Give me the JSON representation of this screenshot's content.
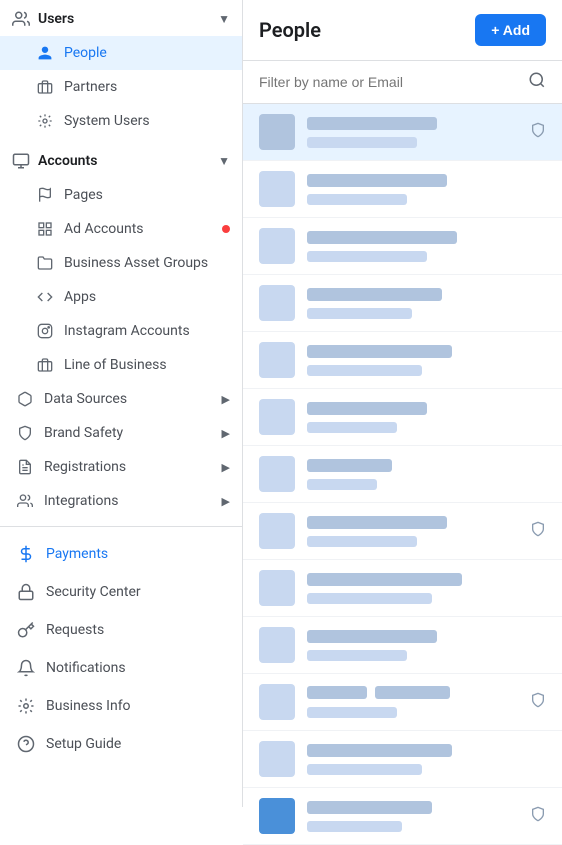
{
  "sidebar": {
    "users_section": {
      "title": "Users",
      "items": [
        {
          "id": "people",
          "label": "People",
          "active": true,
          "icon": "person"
        },
        {
          "id": "partners",
          "label": "Partners",
          "active": false,
          "icon": "handshake"
        },
        {
          "id": "system-users",
          "label": "System Users",
          "active": false,
          "icon": "settings"
        }
      ]
    },
    "accounts_section": {
      "title": "Accounts",
      "items": [
        {
          "id": "pages",
          "label": "Pages",
          "active": false,
          "icon": "flag",
          "dot": false
        },
        {
          "id": "ad-accounts",
          "label": "Ad Accounts",
          "active": false,
          "icon": "grid",
          "dot": true
        },
        {
          "id": "business-asset-groups",
          "label": "Business Asset Groups",
          "active": false,
          "icon": "folder",
          "dot": false
        },
        {
          "id": "apps",
          "label": "Apps",
          "active": false,
          "icon": "apps",
          "dot": false
        },
        {
          "id": "instagram-accounts",
          "label": "Instagram Accounts",
          "active": false,
          "icon": "instagram",
          "dot": false
        },
        {
          "id": "line-of-business",
          "label": "Line of Business",
          "active": false,
          "icon": "briefcase",
          "dot": false
        }
      ]
    },
    "sub_items": [
      {
        "id": "data-sources",
        "label": "Data Sources",
        "icon": "database",
        "has_arrow": true
      },
      {
        "id": "brand-safety",
        "label": "Brand Safety",
        "icon": "shield",
        "has_arrow": true
      },
      {
        "id": "registrations",
        "label": "Registrations",
        "icon": "clipboard",
        "has_arrow": true
      },
      {
        "id": "integrations",
        "label": "Integrations",
        "icon": "people-group",
        "has_arrow": true
      }
    ],
    "bottom_items": [
      {
        "id": "payments",
        "label": "Payments",
        "icon": "credit-card",
        "color": "#1877f2"
      },
      {
        "id": "security-center",
        "label": "Security Center",
        "icon": "lock",
        "color": "#4b4f56"
      },
      {
        "id": "requests",
        "label": "Requests",
        "icon": "key",
        "color": "#4b4f56"
      },
      {
        "id": "notifications",
        "label": "Notifications",
        "icon": "bell",
        "color": "#4b4f56"
      },
      {
        "id": "business-info",
        "label": "Business Info",
        "icon": "gear",
        "color": "#4b4f56"
      },
      {
        "id": "setup-guide",
        "label": "Setup Guide",
        "icon": "question",
        "color": "#4b4f56"
      }
    ]
  },
  "main": {
    "title": "People",
    "add_button_label": "+ Add",
    "filter_placeholder": "Filter by name or Email",
    "rows": [
      {
        "id": 1,
        "has_shield": true,
        "highlighted": true,
        "name_width": 130,
        "email_width": 110
      },
      {
        "id": 2,
        "has_shield": false,
        "highlighted": false,
        "name_width": 140,
        "email_width": 100
      },
      {
        "id": 3,
        "has_shield": false,
        "highlighted": false,
        "name_width": 150,
        "email_width": 120
      },
      {
        "id": 4,
        "has_shield": false,
        "highlighted": false,
        "name_width": 135,
        "email_width": 105
      },
      {
        "id": 5,
        "has_shield": false,
        "highlighted": false,
        "name_width": 145,
        "email_width": 115
      },
      {
        "id": 6,
        "has_shield": false,
        "highlighted": false,
        "name_width": 120,
        "email_width": 90
      },
      {
        "id": 7,
        "has_shield": false,
        "highlighted": false,
        "name_width": 100,
        "email_width": 80
      },
      {
        "id": 8,
        "has_shield": true,
        "highlighted": false,
        "name_width": 140,
        "email_width": 110
      },
      {
        "id": 9,
        "has_shield": false,
        "highlighted": false,
        "name_width": 155,
        "email_width": 125
      },
      {
        "id": 10,
        "has_shield": false,
        "highlighted": false,
        "name_width": 130,
        "email_width": 100
      },
      {
        "id": 11,
        "has_shield": true,
        "highlighted": false,
        "name_width": 115,
        "email_width": 95,
        "has_two_blobs": true
      },
      {
        "id": 12,
        "has_shield": false,
        "highlighted": false,
        "name_width": 145,
        "email_width": 115
      },
      {
        "id": 13,
        "has_shield": true,
        "highlighted": false,
        "name_width": 125,
        "email_width": 95
      }
    ]
  }
}
